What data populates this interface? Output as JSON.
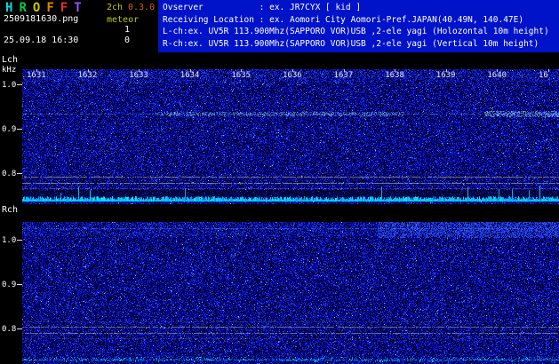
{
  "app": {
    "title_letters": [
      "H",
      "R",
      "O",
      "F",
      "F",
      "T"
    ],
    "channel_mode": "2ch",
    "version": "0.3.0",
    "filename": "2509181630.png",
    "mode": "meteor",
    "count_1": "1",
    "count_2": "0",
    "datetime": "25.09.18 16:30"
  },
  "station_info": {
    "lines": [
      "Ovserver           : ex. JR7CYX [ kid ]",
      "Receiving Location : ex. Aomori City Aomori-Pref.JAPAN(40.49N, 140.47E)",
      "L-ch:ex. UV5R 113.900Mhz(SAPPORO VOR)USB ,2-ele yagi (Holozontal 10m height)",
      "R-ch:ex. UV5R 113.900Mhz(SAPPORO VOR)USB ,2-ele yagi (Vertical 10m height)"
    ]
  },
  "axes": {
    "lch_label": "Lch",
    "rch_label": "Rch",
    "freq_unit": "kHz",
    "lch_ticks": [
      "1.0",
      "0.9",
      "0.8"
    ],
    "rch_ticks": [
      "1.0",
      "0.9",
      "0.8"
    ]
  },
  "time_axis": {
    "labels": [
      "1631",
      "1632",
      "1633",
      "1634",
      "1635",
      "1636",
      "1637",
      "1638",
      "1639",
      "1640",
      "16"
    ]
  },
  "colors": {
    "title_letter_colors": [
      "#00dede",
      "#00cc44",
      "#c8c800",
      "#e08800",
      "#e03030",
      "#9955ff"
    ],
    "channel_mode_color": "#c8c800",
    "version_color": "#d06010",
    "mode_color": "#c8c800",
    "info_panel_bg": "#0013c8",
    "signal_cyan": "#00d8ff",
    "line_yellow": "#bcbc6e",
    "noise_base": "#000026"
  }
}
